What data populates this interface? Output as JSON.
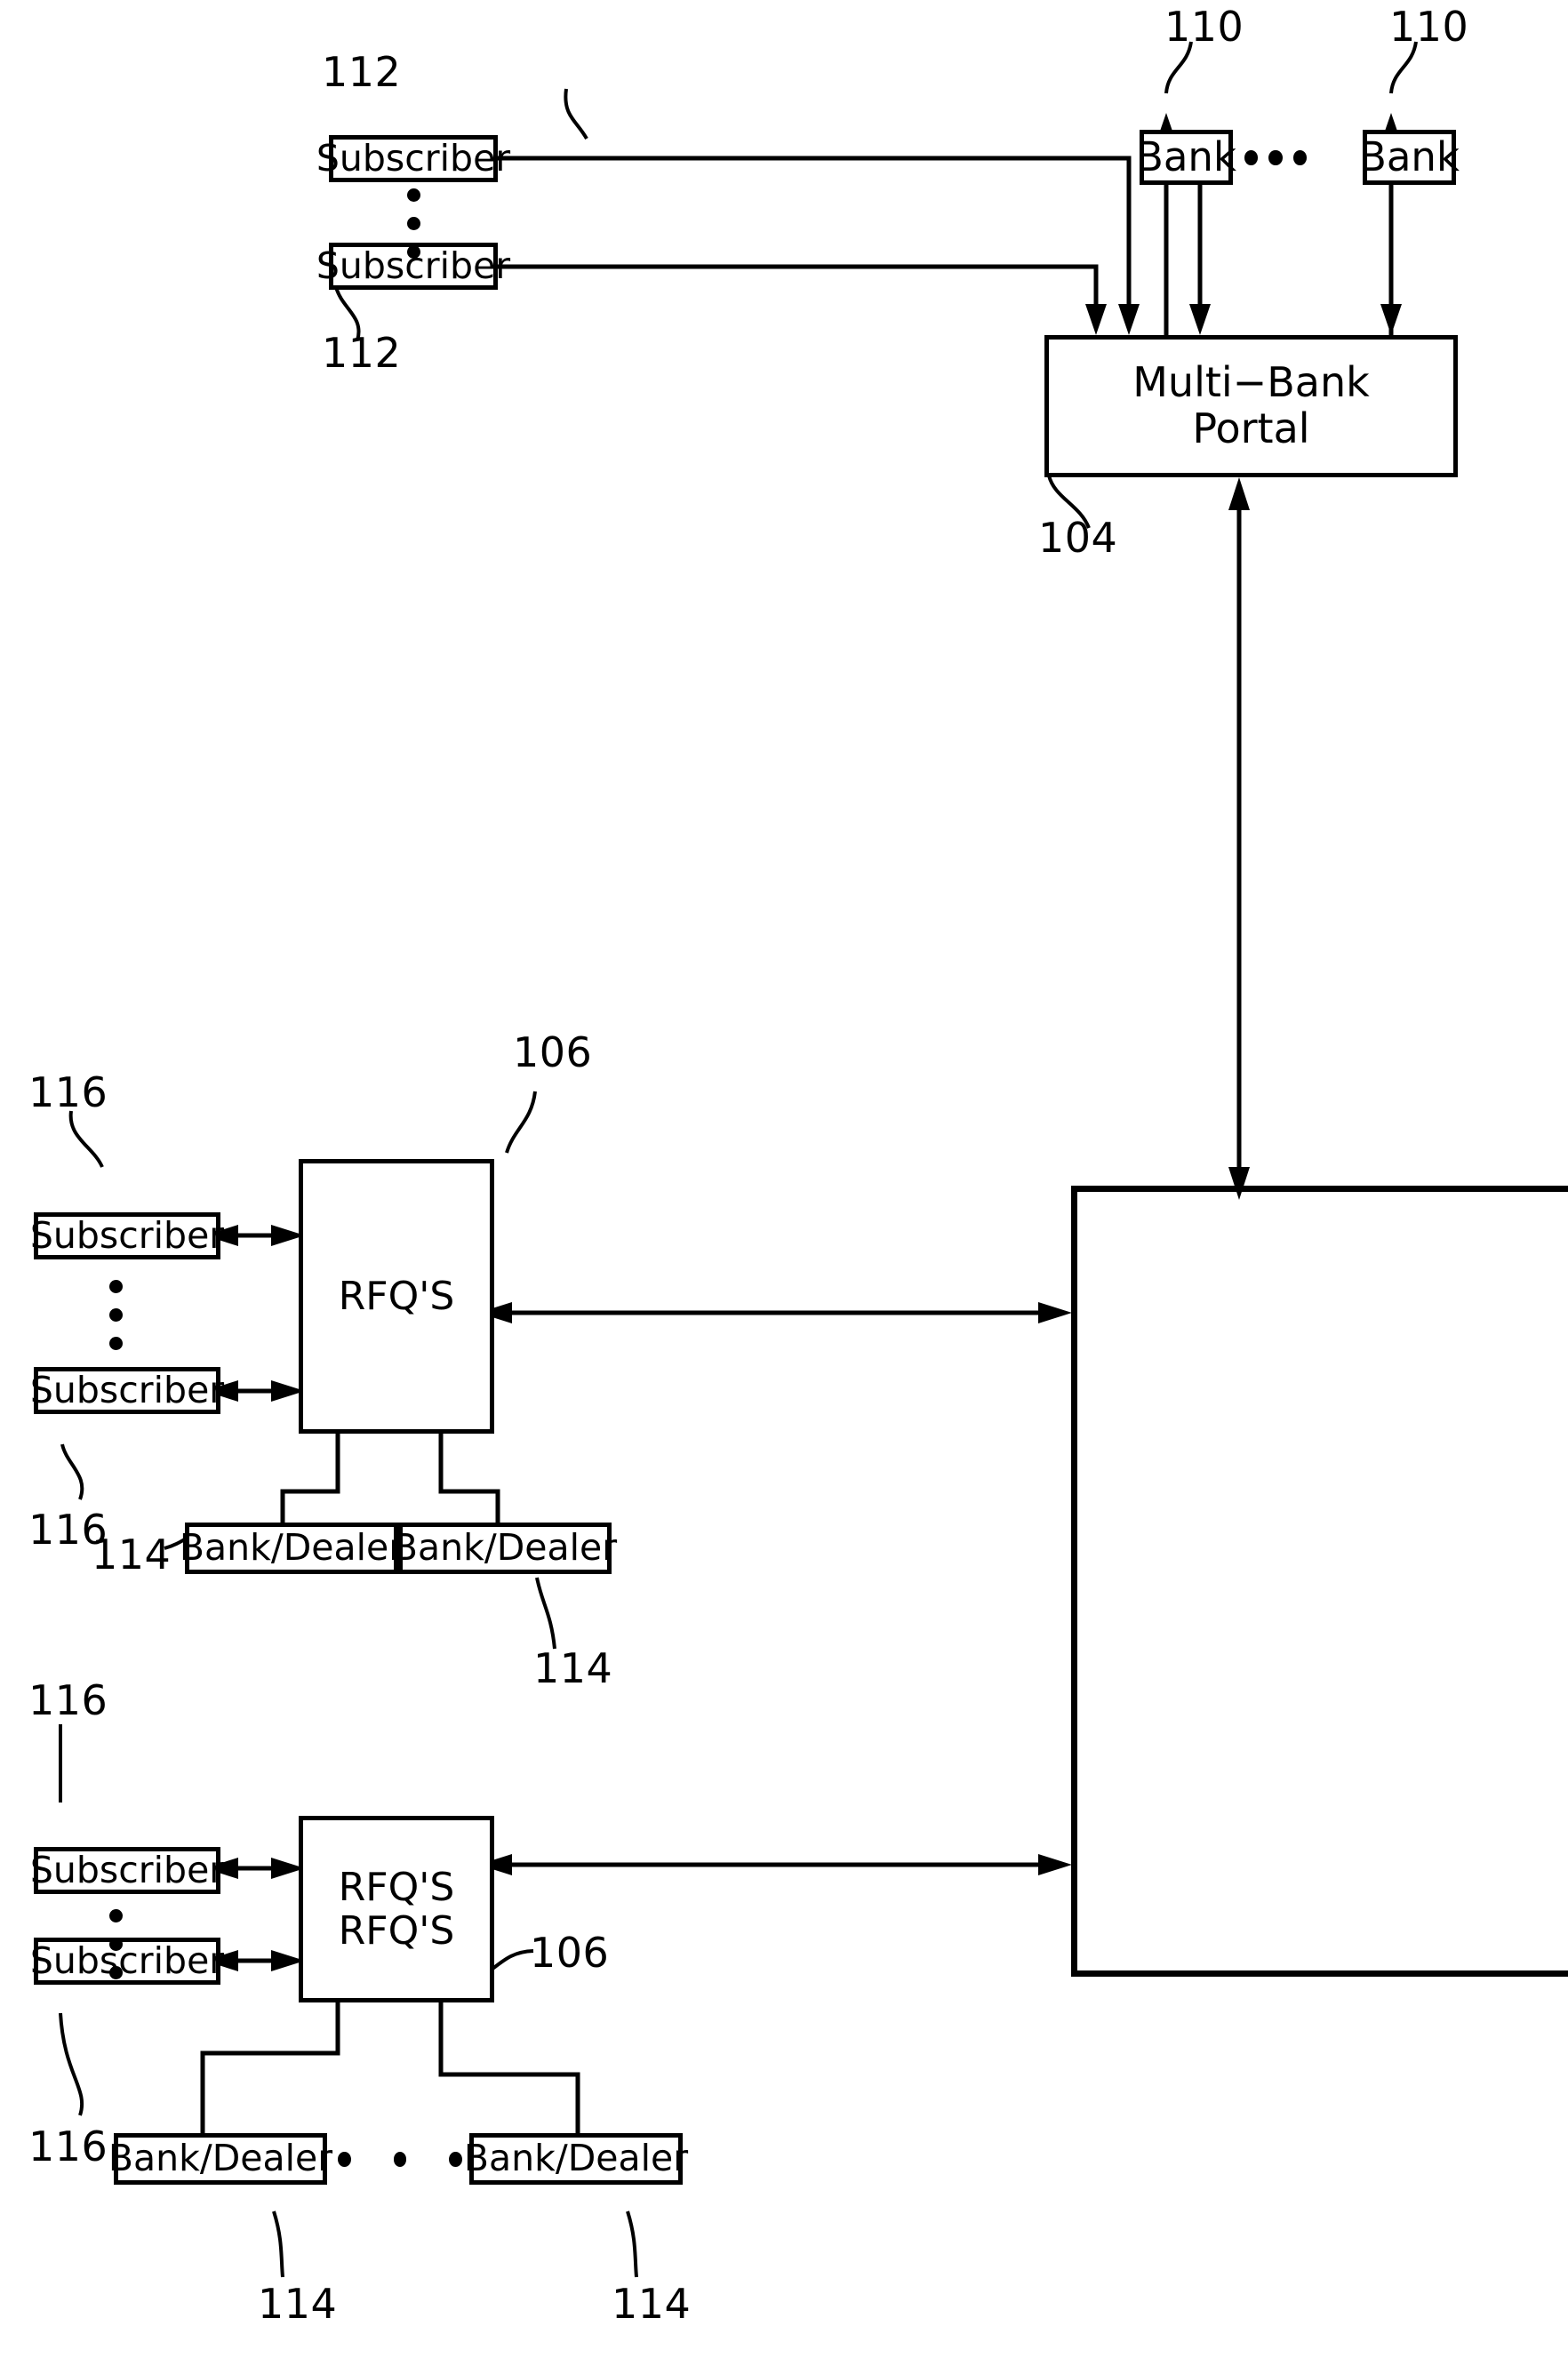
{
  "figure": {
    "type": "patent-block-diagram",
    "background_color": "#ffffff",
    "line_color": "#000000"
  },
  "nodes": {
    "subscriber_top_1": {
      "label": "Subscriber",
      "ref": "112"
    },
    "subscriber_top_2": {
      "label": "Subscriber",
      "ref": "112"
    },
    "bank_1": {
      "label": "Bank",
      "ref": "110"
    },
    "bank_2": {
      "label": "Bank",
      "ref": "110"
    },
    "multi_bank_portal": {
      "label": "Multi−Bank\nPortal",
      "ref": "104"
    },
    "subscriber_mid_1": {
      "label": "Subscriber",
      "ref": "116"
    },
    "subscriber_mid_2": {
      "label": "Subscriber",
      "ref": "116"
    },
    "rfqs_mid": {
      "label": "RFQ'S",
      "ref": "106"
    },
    "bank_dealer_mid_1": {
      "label": "Bank/Dealer",
      "ref": "114"
    },
    "bank_dealer_mid_2": {
      "label": "Bank/Dealer",
      "ref": "114"
    },
    "subscriber_bot_1": {
      "label": "Subscriber",
      "ref": "116"
    },
    "subscriber_bot_2": {
      "label": "Subscriber",
      "ref": "116"
    },
    "rfqs_bot": {
      "label": "RFQ'S\nRFQ'S",
      "ref": "106"
    },
    "bank_dealer_bot_1": {
      "label": "Bank/Dealer",
      "ref": "114"
    },
    "bank_dealer_bot_2": {
      "label": "Bank/Dealer",
      "ref": "114"
    }
  },
  "reference_numerals": [
    {
      "id": "ref-110-a",
      "value": "110"
    },
    {
      "id": "ref-110-b",
      "value": "110"
    },
    {
      "id": "ref-112-a",
      "value": "112"
    },
    {
      "id": "ref-112-b",
      "value": "112"
    },
    {
      "id": "ref-104",
      "value": "104"
    },
    {
      "id": "ref-116-a",
      "value": "116"
    },
    {
      "id": "ref-116-b",
      "value": "116"
    },
    {
      "id": "ref-106-a",
      "value": "106"
    },
    {
      "id": "ref-114-a",
      "value": "114"
    },
    {
      "id": "ref-114-b",
      "value": "114"
    },
    {
      "id": "ref-116-c",
      "value": "116"
    },
    {
      "id": "ref-116-d",
      "value": "116"
    },
    {
      "id": "ref-106-b",
      "value": "106"
    },
    {
      "id": "ref-114-c",
      "value": "114"
    },
    {
      "id": "ref-114-d",
      "value": "114"
    }
  ],
  "ellipses": {
    "banks_between": "•••",
    "subscribers_vertical": "•••",
    "bank_dealers_bottom": "• • •"
  }
}
